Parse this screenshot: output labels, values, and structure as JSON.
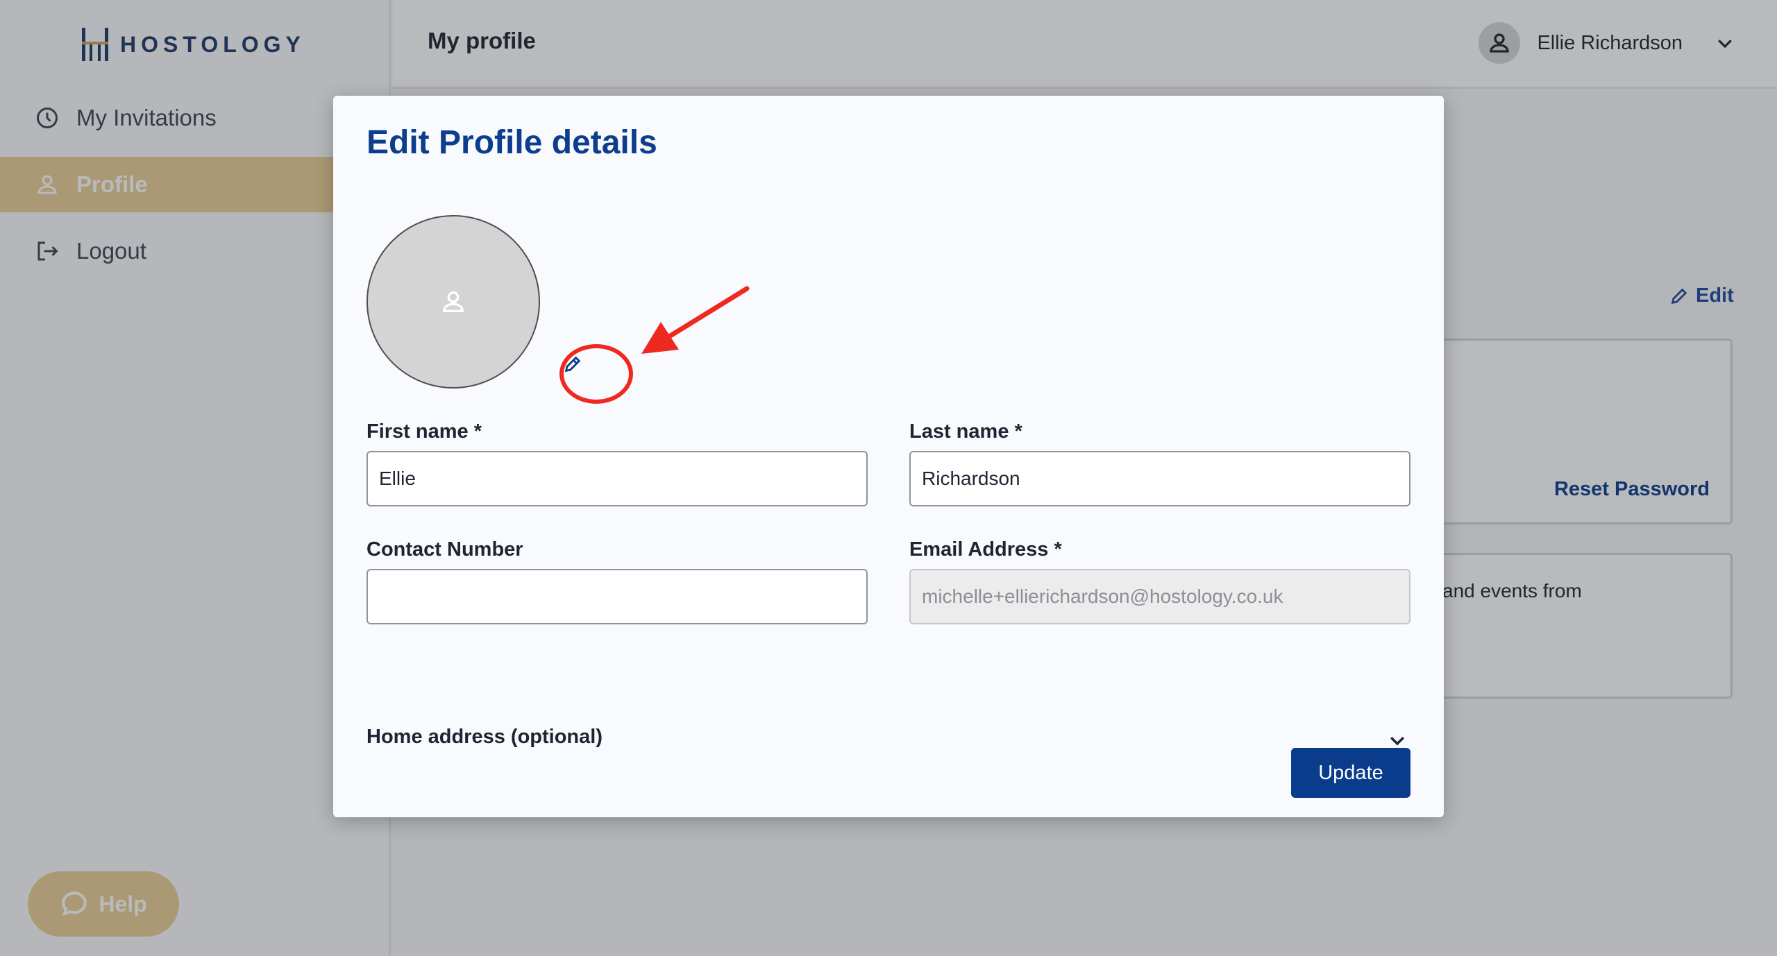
{
  "brand": {
    "name": "HOSTOLOGY"
  },
  "sidebar": {
    "items": [
      {
        "label": "My Invitations",
        "icon": "clock-icon"
      },
      {
        "label": "Profile",
        "icon": "user-icon"
      },
      {
        "label": "Logout",
        "icon": "logout-icon"
      }
    ],
    "help_label": "Help"
  },
  "header": {
    "title": "My profile",
    "user_name": "Ellie Richardson"
  },
  "background_page": {
    "edit_label": "Edit",
    "reset_password_label": "Reset Password",
    "partial_text": "and events from"
  },
  "modal": {
    "title": "Edit Profile details",
    "first_name": {
      "label": "First name *",
      "value": "Ellie"
    },
    "last_name": {
      "label": "Last name *",
      "value": "Richardson"
    },
    "contact_number": {
      "label": "Contact Number",
      "value": ""
    },
    "email": {
      "label": "Email Address *",
      "value": "michelle+ellierichardson@hostology.co.uk"
    },
    "home_address_label": "Home address (optional)",
    "update_label": "Update"
  },
  "colors": {
    "brand_gold": "#e9cf96",
    "brand_navy": "#0b3c8c",
    "annotation_red": "#ee2a20"
  }
}
